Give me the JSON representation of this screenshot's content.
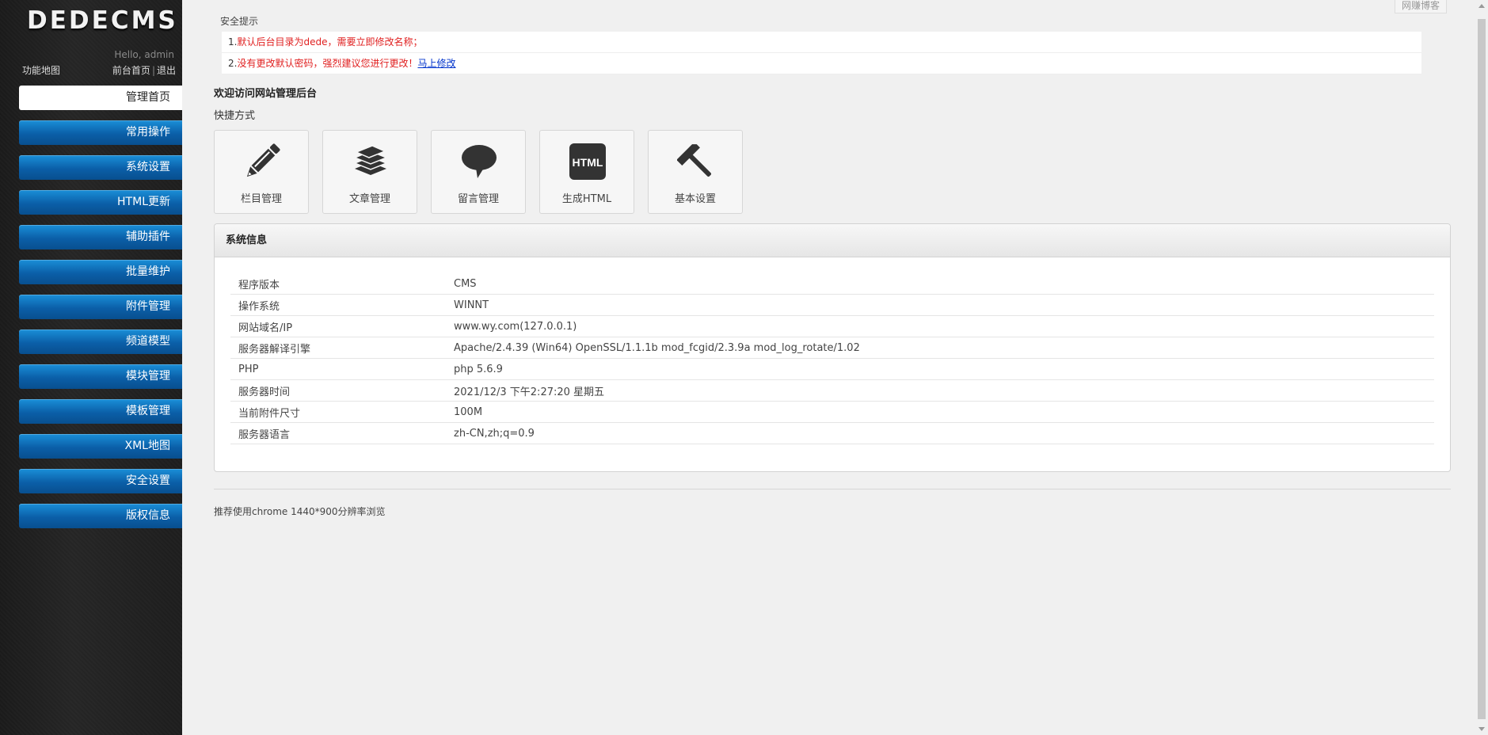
{
  "sidebar": {
    "logo": "DEDECMS",
    "hello": "Hello, admin",
    "sitemap": "功能地图",
    "front_home": "前台首页",
    "separator": "|",
    "logout": "退出",
    "items": [
      {
        "label": "管理首页",
        "active": true
      },
      {
        "label": "常用操作"
      },
      {
        "label": "系统设置"
      },
      {
        "label": "HTML更新"
      },
      {
        "label": "辅助插件"
      },
      {
        "label": "批量维护"
      },
      {
        "label": "附件管理"
      },
      {
        "label": "频道模型"
      },
      {
        "label": "模块管理"
      },
      {
        "label": "模板管理"
      },
      {
        "label": "XML地图"
      },
      {
        "label": "安全设置"
      },
      {
        "label": "版权信息"
      }
    ]
  },
  "security": {
    "title": "安全提示",
    "notices": [
      {
        "num": "1.",
        "text": "默认后台目录为dede，需要立即修改名称；",
        "link": ""
      },
      {
        "num": "2.",
        "text": "没有更改默认密码，强烈建议您进行更改！",
        "link": "马上修改"
      }
    ]
  },
  "welcome": "欢迎访问网站管理后台",
  "shortcuts": {
    "title": "快捷方式",
    "items": [
      {
        "label": "栏目管理",
        "icon": "pencil-icon"
      },
      {
        "label": "文章管理",
        "icon": "stack-icon"
      },
      {
        "label": "留言管理",
        "icon": "speech-bubble-icon"
      },
      {
        "label": "生成HTML",
        "icon": "html-icon",
        "icon_text": "HTML"
      },
      {
        "label": "基本设置",
        "icon": "hammer-icon"
      }
    ]
  },
  "system": {
    "title": "系统信息",
    "rows": [
      {
        "key": "程序版本",
        "value": "CMS"
      },
      {
        "key": "操作系统",
        "value": "WINNT"
      },
      {
        "key": "网站域名/IP",
        "value": "www.wy.com(127.0.0.1)"
      },
      {
        "key": "服务器解译引擎",
        "value": "Apache/2.4.39 (Win64) OpenSSL/1.1.1b mod_fcgid/2.3.9a mod_log_rotate/1.02"
      },
      {
        "key": "PHP",
        "value": "php 5.6.9"
      },
      {
        "key": "服务器时间",
        "value": "2021/12/3 下午2:27:20 星期五"
      },
      {
        "key": "当前附件尺寸",
        "value": "100M"
      },
      {
        "key": "服务器语言",
        "value": "zh-CN,zh;q=0.9"
      }
    ]
  },
  "footer": "推荐使用chrome 1440*900分辨率浏览",
  "corner_tab": "网赚博客",
  "colors": {
    "nav_blue": "#0b5fa8",
    "warning_red": "#e02020",
    "link_blue": "#0033cc"
  }
}
